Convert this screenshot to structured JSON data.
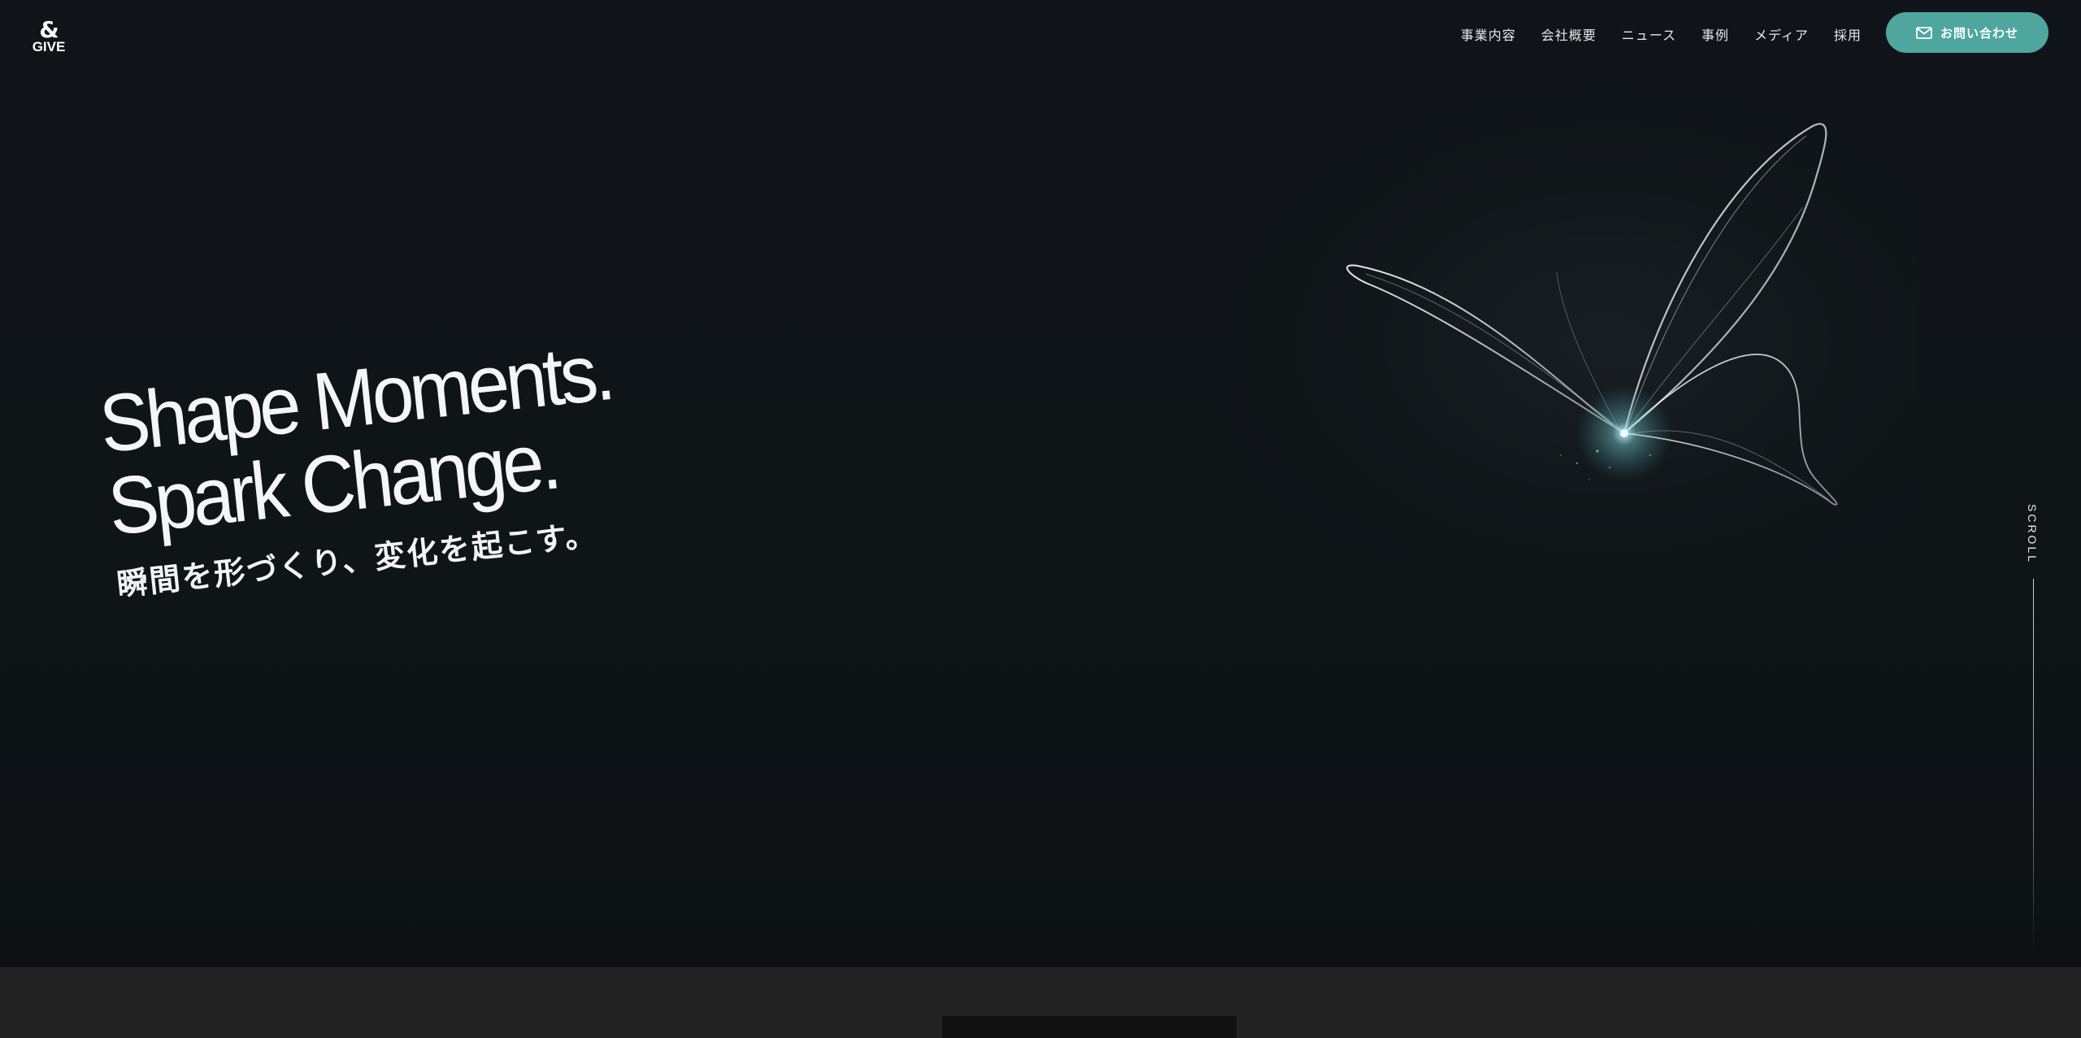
{
  "header": {
    "logo": {
      "symbol": "&",
      "word": "GIVE"
    },
    "nav": [
      {
        "label": "事業内容"
      },
      {
        "label": "会社概要"
      },
      {
        "label": "ニュース"
      },
      {
        "label": "事例"
      },
      {
        "label": "メディア"
      },
      {
        "label": "採用"
      }
    ],
    "contact_button": {
      "label": "お問い合わせ",
      "icon": "mail-icon"
    }
  },
  "hero": {
    "headline_line1": "Shape Moments.",
    "headline_line2": "Spark Change.",
    "subheadline": "瞬間を形づくり、変化を起こす。",
    "art_icon": "butterfly-icon",
    "scroll_label": "SCROLL"
  },
  "colors": {
    "background": "#0f1316",
    "accent": "#4ea69f",
    "band": "#232323"
  }
}
